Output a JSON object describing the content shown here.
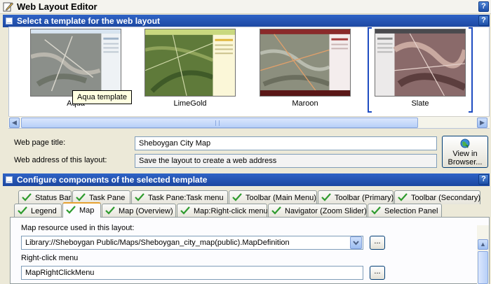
{
  "app": {
    "title": "Web Layout Editor",
    "help_label": "?"
  },
  "template_section": {
    "title": "Select a template for the web layout",
    "help_label": "?",
    "templates": [
      {
        "label": "Aqua"
      },
      {
        "label": "LimeGold"
      },
      {
        "label": "Maroon"
      },
      {
        "label": "Slate"
      }
    ],
    "selected": "Slate",
    "tooltip": "Aqua template"
  },
  "form": {
    "page_title_label": "Web page title:",
    "page_title_value": "Sheboygan City Map",
    "web_address_label": "Web address of this layout:",
    "web_address_value": "Save the layout to create a web address",
    "view_button_line1": "View in",
    "view_button_line2": "Browser..."
  },
  "components_section": {
    "title": "Configure components of the selected template",
    "help_label": "?",
    "tabs_row1": [
      "Status Bar",
      "Task Pane",
      "Task Pane:Task menu",
      "Toolbar (Main Menu)",
      "Toolbar (Primary)",
      "Toolbar (Secondary)"
    ],
    "tabs_row2": [
      "Legend",
      "Map",
      "Map (Overview)",
      "Map:Right-click menu",
      "Navigator (Zoom Slider)",
      "Selection Panel"
    ],
    "active_tab": "Map",
    "map_resource_label": "Map resource used in this layout:",
    "map_resource_value": "Library://Sheboygan Public/Maps/Sheboygan_city_map(public).MapDefinition",
    "right_click_label": "Right-click menu",
    "right_click_value": "MapRightClickMenu",
    "browse_label": "..."
  },
  "colors": {
    "accent": "#1d47a0",
    "check_green": "#2e9b2e",
    "active_tab_highlight": "#e6a131"
  }
}
